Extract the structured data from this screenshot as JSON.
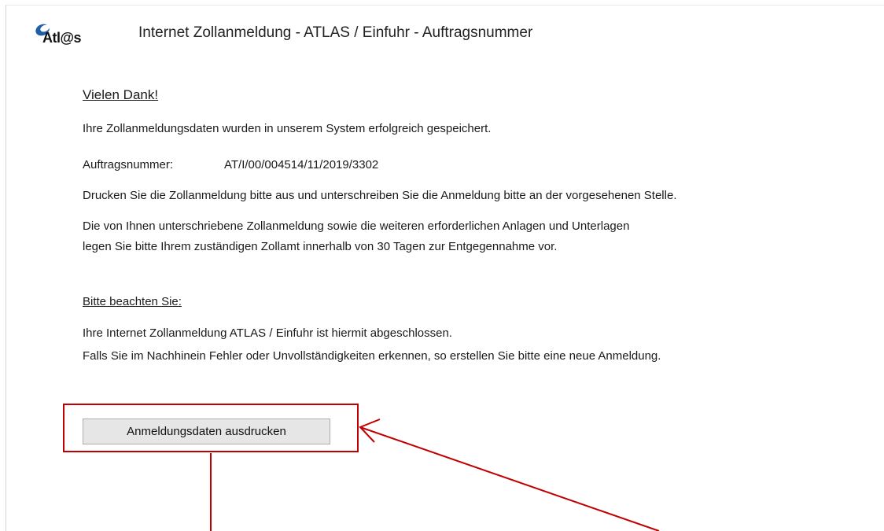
{
  "header": {
    "logo_text": "Atl@s",
    "title": "Internet Zollanmeldung  -  ATLAS / Einfuhr  -  Auftragsnummer"
  },
  "main": {
    "thanks": "Vielen Dank!",
    "saved_message": "Ihre Zollanmeldungsdaten wurden in unserem System erfolgreich gespeichert.",
    "order_label": "Auftragsnummer:",
    "order_number": "AT/I/00/004514/11/2019/3302",
    "print_instruction": "Drucken Sie die Zollanmeldung bitte aus und unterschreiben Sie die Anmeldung bitte an der vorgesehenen Stelle.",
    "submit_line1": "Die von Ihnen unterschriebene Zollanmeldung sowie die weiteren erforderlichen Anlagen und Unterlagen",
    "submit_line2": "legen Sie bitte Ihrem zuständigen Zollamt innerhalb von 30 Tagen zur Entgegennahme vor.",
    "notice_heading": "Bitte beachten Sie:",
    "notice_line1": "Ihre Internet Zollanmeldung ATLAS / Einfuhr ist hiermit abgeschlossen.",
    "notice_line2": "Falls Sie im Nachhinein Fehler oder Unvollständigkeiten erkennen, so erstellen Sie bitte eine neue Anmeldung."
  },
  "actions": {
    "print_label": "Anmeldungsdaten ausdrucken"
  },
  "colors": {
    "annotation": "#c00000",
    "button_bg": "#e6e6e6",
    "logo_blue": "#1f5fa8"
  }
}
